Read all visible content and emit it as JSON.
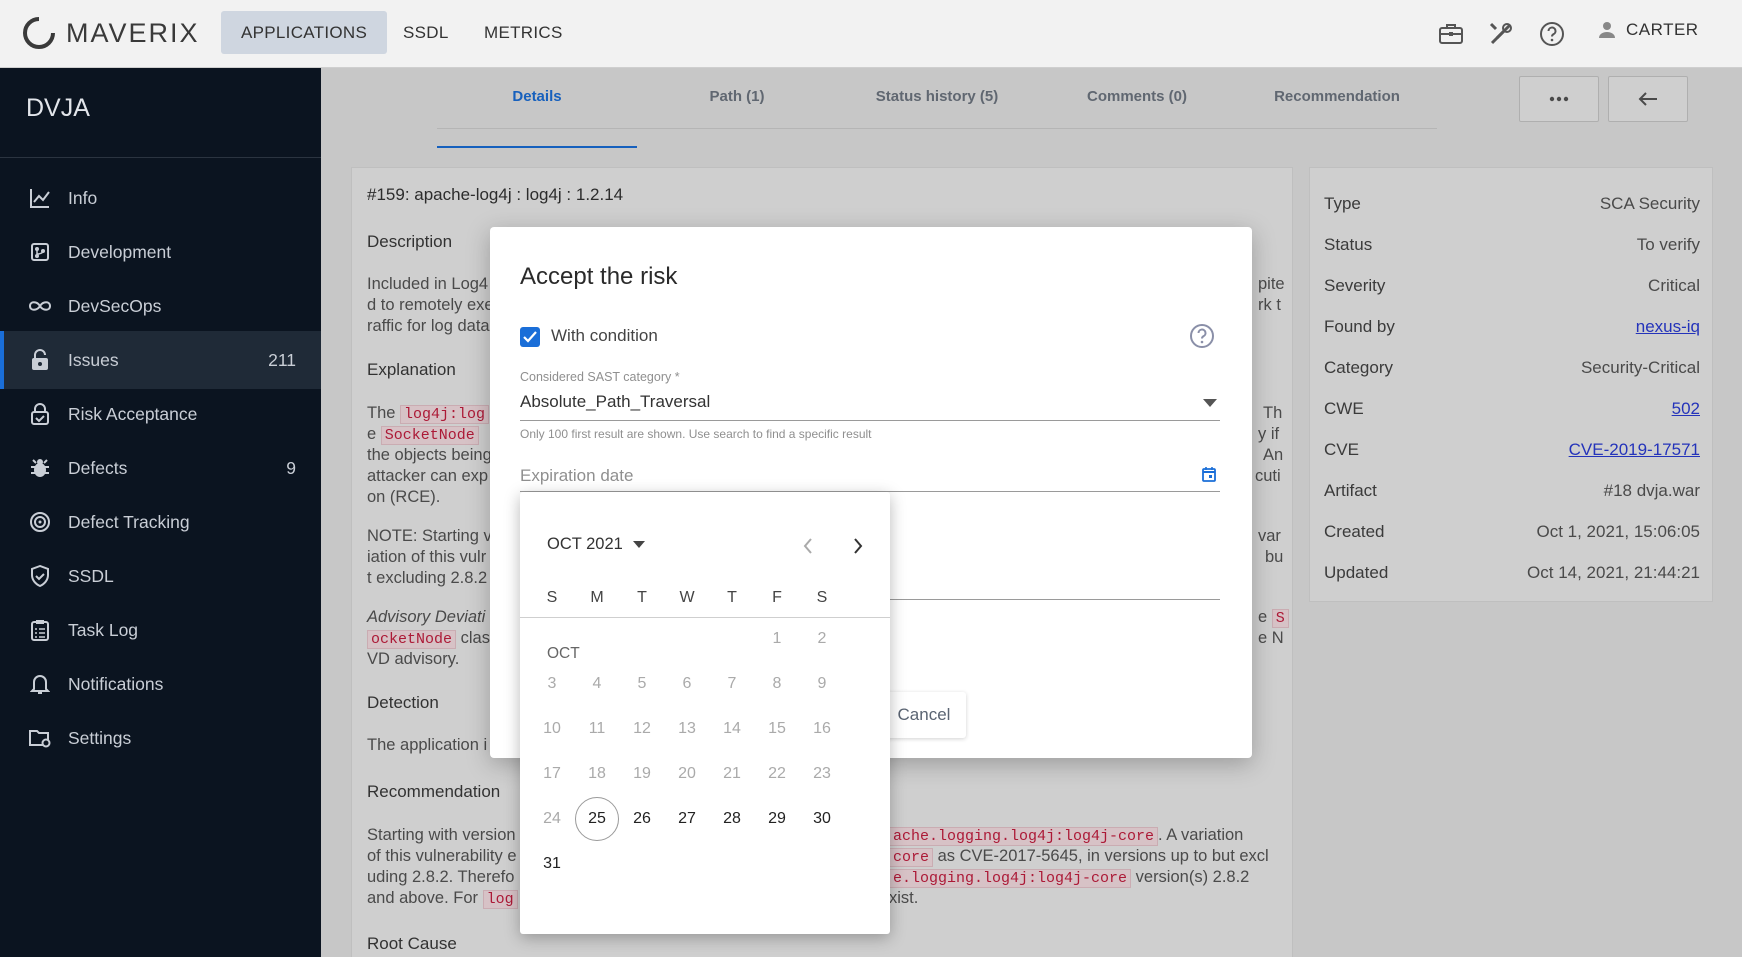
{
  "topbar": {
    "logo_text": "MAVERIX",
    "nav": [
      {
        "label": "APPLICATIONS",
        "active": true
      },
      {
        "label": "SSDL",
        "active": false
      },
      {
        "label": "METRICS",
        "active": false
      }
    ],
    "icons": [
      "briefcase-icon",
      "tools-icon",
      "help-icon"
    ],
    "user_name": "CARTER"
  },
  "sidebar": {
    "app_title": "DVJA",
    "items": [
      {
        "label": "Info",
        "count": "",
        "icon": "chart-line-icon"
      },
      {
        "label": "Development",
        "count": "",
        "icon": "code-branch-icon"
      },
      {
        "label": "DevSecOps",
        "count": "",
        "icon": "infinity-icon"
      },
      {
        "label": "Issues",
        "count": "211",
        "icon": "lock-icon",
        "active": true
      },
      {
        "label": "Risk Acceptance",
        "count": "",
        "icon": "shield-lock-icon"
      },
      {
        "label": "Defects",
        "count": "9",
        "icon": "bug-icon"
      },
      {
        "label": "Defect Tracking",
        "count": "",
        "icon": "target-icon"
      },
      {
        "label": "SSDL",
        "count": "",
        "icon": "shield-check-icon"
      },
      {
        "label": "Task Log",
        "count": "",
        "icon": "clipboard-icon"
      },
      {
        "label": "Notifications",
        "count": "",
        "icon": "bell-icon"
      },
      {
        "label": "Settings",
        "count": "",
        "icon": "folder-gear-icon"
      }
    ]
  },
  "tabs": [
    {
      "label": "Details",
      "active": true
    },
    {
      "label": "Path (1)"
    },
    {
      "label": "Status history (5)"
    },
    {
      "label": "Comments (0)"
    },
    {
      "label": "Recommendation"
    }
  ],
  "issue": {
    "title": "#159: apache-log4j : log4j : 1.2.14",
    "description_heading": "Description",
    "description_l1": "Included in Log4",
    "description_l1_end": "pite",
    "description_l2": "d to remotely exe",
    "description_l2_end": "rk t",
    "description_l3": "raffic for log data",
    "explanation_heading": "Explanation",
    "expl_l1_a": "The",
    "expl_l1_code": "log4j:log",
    "expl_l1_end": "Th",
    "expl_l2_a": "e",
    "expl_l2_code": "SocketNode",
    "expl_l2_end": "y if",
    "expl_l3": "the objects being",
    "expl_l3_end": "An",
    "expl_l4": "attacker can exp",
    "expl_l4_end": "cuti",
    "expl_l5": "on (RCE).",
    "note_l1": "NOTE: Starting v",
    "note_l1_end": "var",
    "note_l2": "iation of this vulr",
    "note_l2_end": "bu",
    "note_l3": "t excluding 2.8.2",
    "adv_l1": "Advisory Deviati",
    "adv_l1_code": "S",
    "adv_l1_pre": "e",
    "adv_l2_code": "ocketNode",
    "adv_l2": "clas",
    "adv_l2_end": "e N",
    "adv_l3": "VD advisory.",
    "detection_heading": "Detection",
    "detection_text": "The application i",
    "recommendation_heading": "Recommendation",
    "rec_l1": "Starting with version",
    "rec_l1_code": "ache.logging.log4j:log4j-core",
    "rec_l1_end": ". A variation",
    "rec_l2": "of this vulnerability e",
    "rec_l2_code": "core",
    "rec_l2_end": "as CVE-2017-5645, in versions up to but excl",
    "rec_l3": "uding 2.8.2. Therefo",
    "rec_l3_code": "e.logging.log4j:log4j-core",
    "rec_l3_end": "version(s) 2.8.2",
    "rec_l4": "and above. For",
    "rec_l4_code": "log",
    "rec_l4_end": "xist.",
    "root_cause_heading": "Root Cause"
  },
  "details": [
    {
      "key": "Type",
      "value": "SCA Security"
    },
    {
      "key": "Status",
      "value": "To verify"
    },
    {
      "key": "Severity",
      "value": "Critical"
    },
    {
      "key": "Found by",
      "value": "nexus-iq",
      "link": true
    },
    {
      "key": "Category",
      "value": "Security-Critical"
    },
    {
      "key": "CWE",
      "value": "502",
      "link": true
    },
    {
      "key": "CVE",
      "value": "CVE-2019-17571",
      "link": true
    },
    {
      "key": "Artifact",
      "value": "#18 dvja.war"
    },
    {
      "key": "Created",
      "value": "Oct 1, 2021, 15:06:05"
    },
    {
      "key": "Updated",
      "value": "Oct 14, 2021, 21:44:21"
    }
  ],
  "dialog": {
    "title": "Accept the risk",
    "with_condition_label": "With condition",
    "with_condition_checked": true,
    "sast_label": "Considered SAST category *",
    "sast_value": "Absolute_Path_Traversal",
    "sast_hint": "Only 100 first result are shown. Use search to find a specific result",
    "expiration_placeholder": "Expiration date",
    "cancel_label": "Cancel"
  },
  "datepicker": {
    "period_label": "OCT 2021",
    "month_label": "OCT",
    "weekdays": [
      "S",
      "M",
      "T",
      "W",
      "T",
      "F",
      "S"
    ],
    "days": [
      "1",
      "2",
      "3",
      "4",
      "5",
      "6",
      "7",
      "8",
      "9",
      "10",
      "11",
      "12",
      "13",
      "14",
      "15",
      "16",
      "17",
      "18",
      "19",
      "20",
      "21",
      "22",
      "23",
      "24",
      "25",
      "26",
      "27",
      "28",
      "29",
      "30",
      "31"
    ],
    "today": "25",
    "first_enabled": "25",
    "accent_color": "#1a6ed8"
  }
}
